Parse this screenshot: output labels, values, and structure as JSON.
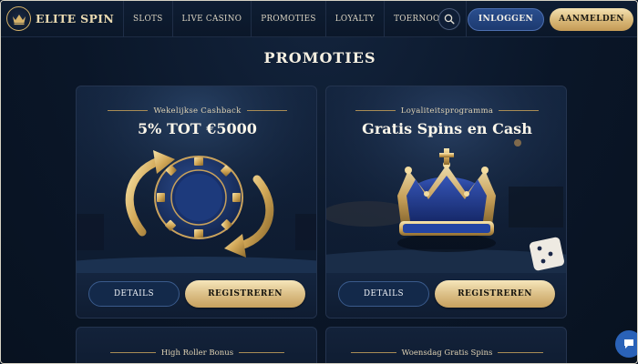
{
  "brand": {
    "name": "ELITE SPIN"
  },
  "nav": {
    "items": [
      {
        "label": "SLOTS"
      },
      {
        "label": "LIVE CASINO"
      },
      {
        "label": "PROMOTIES"
      },
      {
        "label": "LOYALTY"
      },
      {
        "label": "TOERNOOIEN"
      }
    ],
    "login_label": "INLOGGEN",
    "signup_label": "AANMELDEN",
    "search_icon": "search-icon"
  },
  "page": {
    "title": "PROMOTIES"
  },
  "promotions": [
    {
      "eyebrow": "Wekelijkse Cashback",
      "headline": "5% TOT €5000",
      "details_label": "DETAILS",
      "register_label": "REGISTREREN",
      "icon": "cashback-chip-icon"
    },
    {
      "eyebrow": "Loyaliteitsprogramma",
      "headline": "Gratis Spins en Cash",
      "details_label": "DETAILS",
      "register_label": "REGISTREREN",
      "icon": "crown-icon"
    },
    {
      "eyebrow": "High Roller Bonus"
    },
    {
      "eyebrow": "Woensdag Gratis Spins"
    }
  ],
  "colors": {
    "background": "#0a1628",
    "gold": "#d8b777",
    "blue_button": "#2a4e8e",
    "chat": "#2a62b8"
  }
}
